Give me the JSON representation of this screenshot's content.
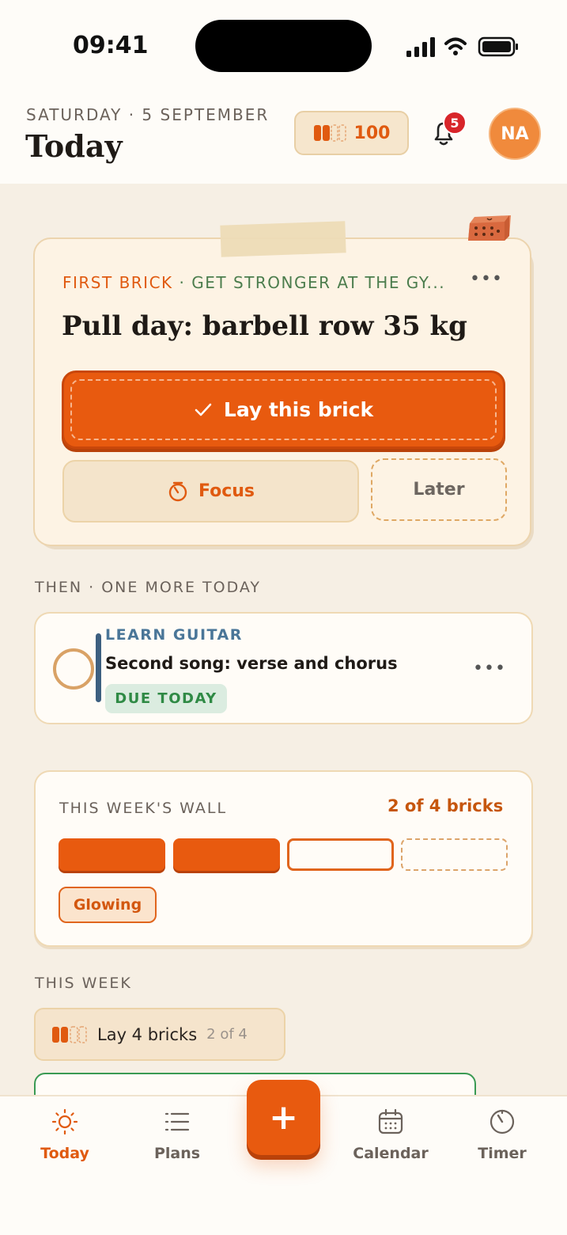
{
  "status_bar": {
    "time": "09:41"
  },
  "header": {
    "date": "SATURDAY · 5 SEPTEMBER",
    "title": "Today",
    "points": "100",
    "notifications_count": "5",
    "avatar_initials": "NA"
  },
  "first_brick": {
    "label": "FIRST BRICK",
    "goal": "· GET STRONGER AT THE GY...",
    "title": "Pull day: barbell row 35 kg",
    "lay_button": "Lay this brick",
    "focus_button": "Focus",
    "later_button": "Later"
  },
  "then_section": {
    "label": "THEN · ONE MORE TODAY",
    "task": {
      "plan": "LEARN GUITAR",
      "title": "Second song: verse and chorus",
      "badge": "DUE TODAY"
    }
  },
  "week_wall": {
    "label": "THIS WEEK'S WALL",
    "count": "2 of 4 bricks",
    "bricks": [
      "laid",
      "laid",
      "next",
      "empty"
    ],
    "status": "Glowing"
  },
  "this_week": {
    "label": "THIS WEEK",
    "goal_text": "Lay 4 bricks",
    "goal_progress": "2 of 4"
  },
  "tabs": {
    "today": "Today",
    "plans": "Plans",
    "add": "+",
    "calendar": "Calendar",
    "timer": "Timer"
  },
  "colors": {
    "accent": "#e85a0f",
    "background": "#f6efe4",
    "goal_green": "#4c7d4d",
    "plan_blue": "#4a7698"
  }
}
